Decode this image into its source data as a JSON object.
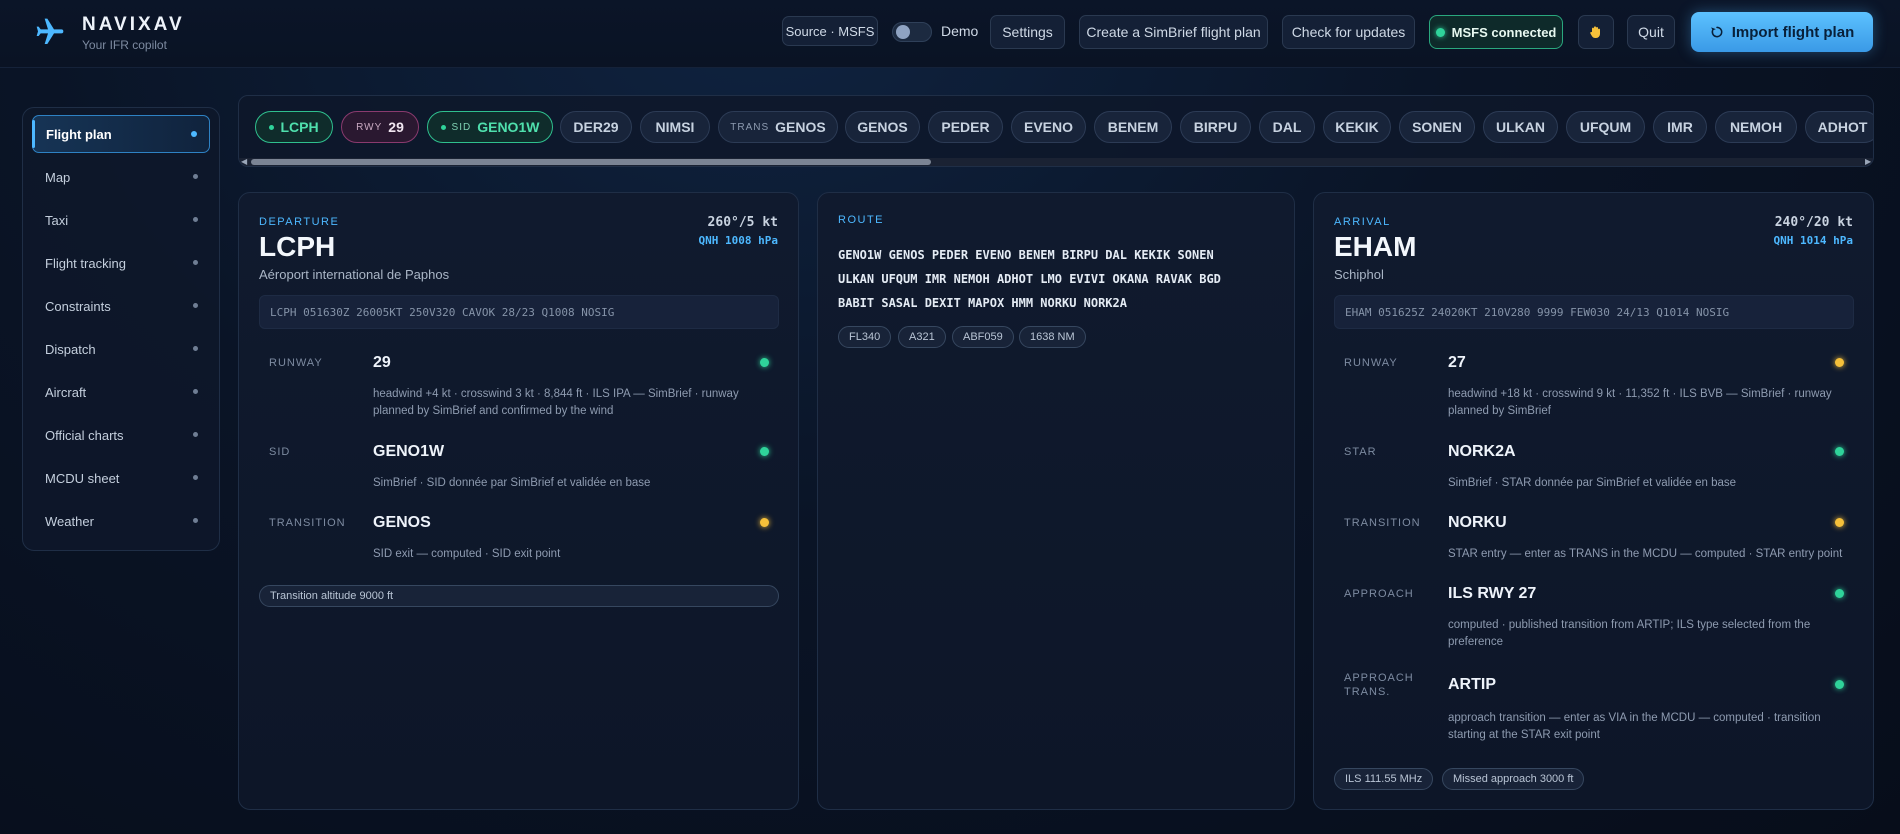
{
  "app": {
    "name": "NAVIXAV",
    "tagline": "Your IFR copilot"
  },
  "header": {
    "source_label": "Source · MSFS",
    "demo_label": "Demo",
    "settings_label": "Settings",
    "simbrief_label": "Create a SimBrief flight plan",
    "updates_label": "Check for updates",
    "connection_label": "MSFS connected",
    "quit_label": "Quit",
    "import_label": "Import flight plan"
  },
  "sidebar": {
    "items": [
      {
        "label": "Flight plan",
        "active": true
      },
      {
        "label": "Map"
      },
      {
        "label": "Taxi"
      },
      {
        "label": "Flight tracking"
      },
      {
        "label": "Constraints"
      },
      {
        "label": "Dispatch"
      },
      {
        "label": "Aircraft"
      },
      {
        "label": "Official charts"
      },
      {
        "label": "MCDU sheet"
      },
      {
        "label": "Weather"
      }
    ]
  },
  "chips": [
    {
      "kind": "",
      "label": "LCPH",
      "style": "green"
    },
    {
      "kind": "RWY",
      "label": "29",
      "style": "magenta"
    },
    {
      "kind": "SID",
      "label": "GENO1W",
      "style": "green"
    },
    {
      "kind": "",
      "label": "DER29"
    },
    {
      "kind": "",
      "label": "NIMSI"
    },
    {
      "kind": "TRANS",
      "label": "GENOS"
    },
    {
      "kind": "",
      "label": "GENOS"
    },
    {
      "kind": "",
      "label": "PEDER"
    },
    {
      "kind": "",
      "label": "EVENO"
    },
    {
      "kind": "",
      "label": "BENEM"
    },
    {
      "kind": "",
      "label": "BIRPU"
    },
    {
      "kind": "",
      "label": "DAL"
    },
    {
      "kind": "",
      "label": "KEKIK"
    },
    {
      "kind": "",
      "label": "SONEN"
    },
    {
      "kind": "",
      "label": "ULKAN"
    },
    {
      "kind": "",
      "label": "UFQUM"
    },
    {
      "kind": "",
      "label": "IMR"
    },
    {
      "kind": "",
      "label": "NEMOH"
    },
    {
      "kind": "",
      "label": "ADHOT"
    }
  ],
  "departure": {
    "section": "DEPARTURE",
    "icao": "LCPH",
    "name": "Aéroport international de Paphos",
    "wind": "260°/5 kt",
    "qnh": "QNH 1008 hPa",
    "metar": "LCPH 051630Z 26005KT 250V320 CAVOK 28/23 Q1008 NOSIG",
    "rows": [
      {
        "label": "RUNWAY",
        "value": "29",
        "desc1": "headwind +4 kt · crosswind 3 kt · 8,844 ft · ILS IPA — SimBrief · runway",
        "desc2": "planned by SimBrief and confirmed by the wind",
        "status": "green"
      },
      {
        "label": "SID",
        "value": "GENO1W",
        "desc1": "SimBrief · SID donnée par SimBrief et validée en base",
        "status": "green"
      },
      {
        "label": "TRANSITION",
        "value": "GENOS",
        "desc1": "SID exit — computed · SID exit point",
        "status": "yellow"
      }
    ],
    "pills": [
      "Transition altitude 9000 ft"
    ]
  },
  "route": {
    "section": "ROUTE",
    "line1": "GENO1W GENOS PEDER EVENO BENEM BIRPU DAL KEKIK SONEN",
    "line2": "ULKAN UFQUM IMR NEMOH ADHOT LMO EVIVI OKANA RAVAK BGD",
    "line3": "BABIT SASAL DEXIT MAPOX HMM NORKU NORK2A",
    "tags": [
      "FL340",
      "A321",
      "ABF059",
      "1638 NM"
    ]
  },
  "arrival": {
    "section": "ARRIVAL",
    "icao": "EHAM",
    "name": "Schiphol",
    "wind": "240°/20 kt",
    "qnh": "QNH 1014 hPa",
    "metar": "EHAM 051625Z 24020KT 210V280 9999 FEW030 24/13 Q1014 NOSIG",
    "rows": [
      {
        "label": "RUNWAY",
        "value": "27",
        "desc1": "headwind +18 kt · crosswind 9 kt · 11,352 ft · ILS BVB — SimBrief · runway",
        "desc2": "planned by SimBrief",
        "status": "yellow"
      },
      {
        "label": "STAR",
        "value": "NORK2A",
        "desc1": "SimBrief · STAR donnée par SimBrief et validée en base",
        "status": "green"
      },
      {
        "label": "TRANSITION",
        "value": "NORKU",
        "desc1": "STAR entry — enter as TRANS in the MCDU — computed · STAR entry point",
        "status": "yellow"
      },
      {
        "label": "APPROACH",
        "value": "ILS RWY 27",
        "desc1": "computed · published transition from ARTIP; ILS type selected from the",
        "desc2": "preference",
        "status": "green"
      },
      {
        "label": "APPROACH",
        "label2": "TRANS.",
        "value": "ARTIP",
        "desc1": "approach transition — enter as VIA in the MCDU — computed · transition",
        "desc2": "starting at the STAR exit point",
        "status": "green"
      }
    ],
    "pills": [
      "ILS 111.55 MHz",
      "Missed approach 3000 ft"
    ]
  },
  "colors": {
    "accent": "#4db8ff",
    "ok": "#2fd39a",
    "warn": "#f5c03a",
    "background": "#0a1426"
  }
}
